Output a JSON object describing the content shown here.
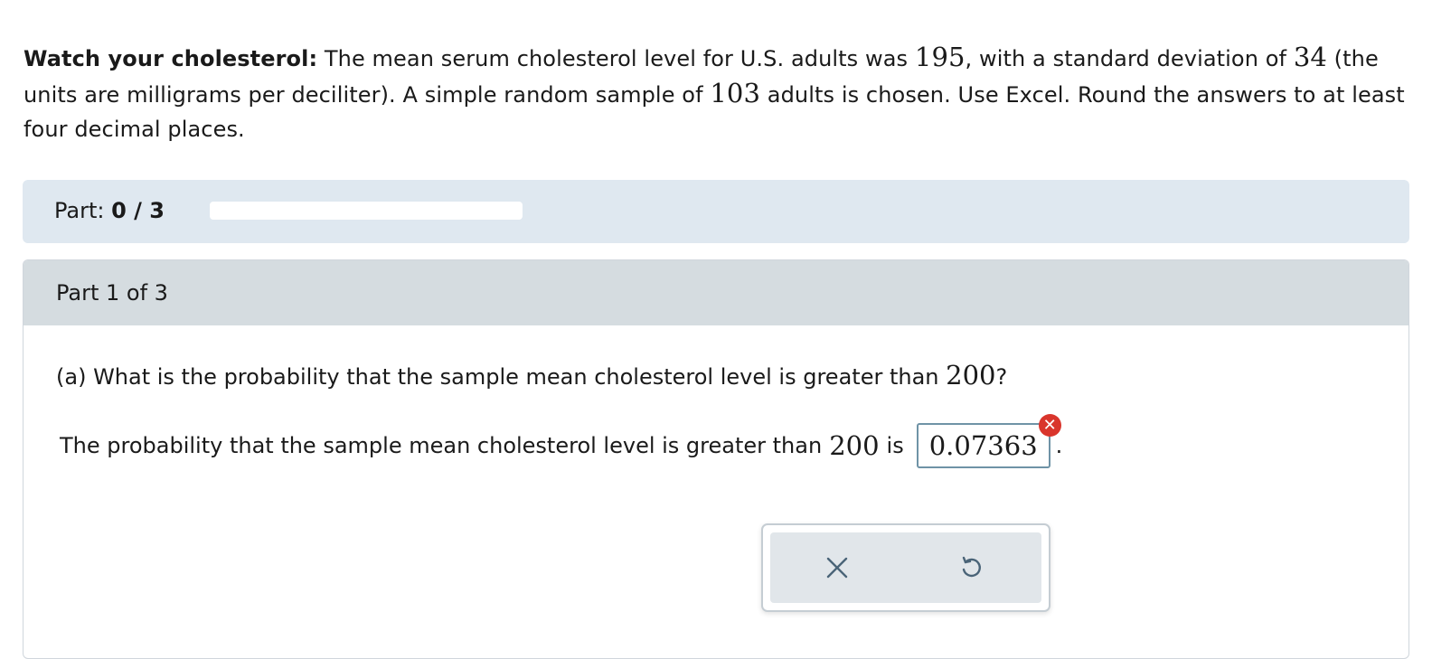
{
  "problem": {
    "title": "Watch your cholesterol:",
    "text_1": "The mean serum cholesterol level for U.S. adults was",
    "mean": "195",
    "text_2": ", with a standard deviation of",
    "sd": "34",
    "text_3": "(the units are milligrams per deciliter). A simple random sample of",
    "n": "103",
    "text_4": "adults is chosen. Use Excel. Round the answers to at least four decimal places."
  },
  "progress": {
    "label": "Part:",
    "count": "0 / 3",
    "fraction": 0
  },
  "part": {
    "header": "Part 1 of 3",
    "question_text": "(a) What is the probability that the sample mean cholesterol level is greater than",
    "question_value": "200",
    "question_end": "?",
    "answer_text": "The probability that the sample mean cholesterol level is greater than",
    "answer_value_label": "200",
    "answer_is": "is",
    "answer_input": "0.07363",
    "answer_period": ".",
    "error_mark": "✕"
  },
  "actions": {
    "clear_icon": "close-icon",
    "undo_icon": "undo-icon"
  },
  "colors": {
    "progress_bg": "#dfe8f0",
    "part_header_bg": "#d5dce0",
    "error": "#d9352c",
    "input_border": "#6f93a6",
    "icon": "#4a6478"
  }
}
